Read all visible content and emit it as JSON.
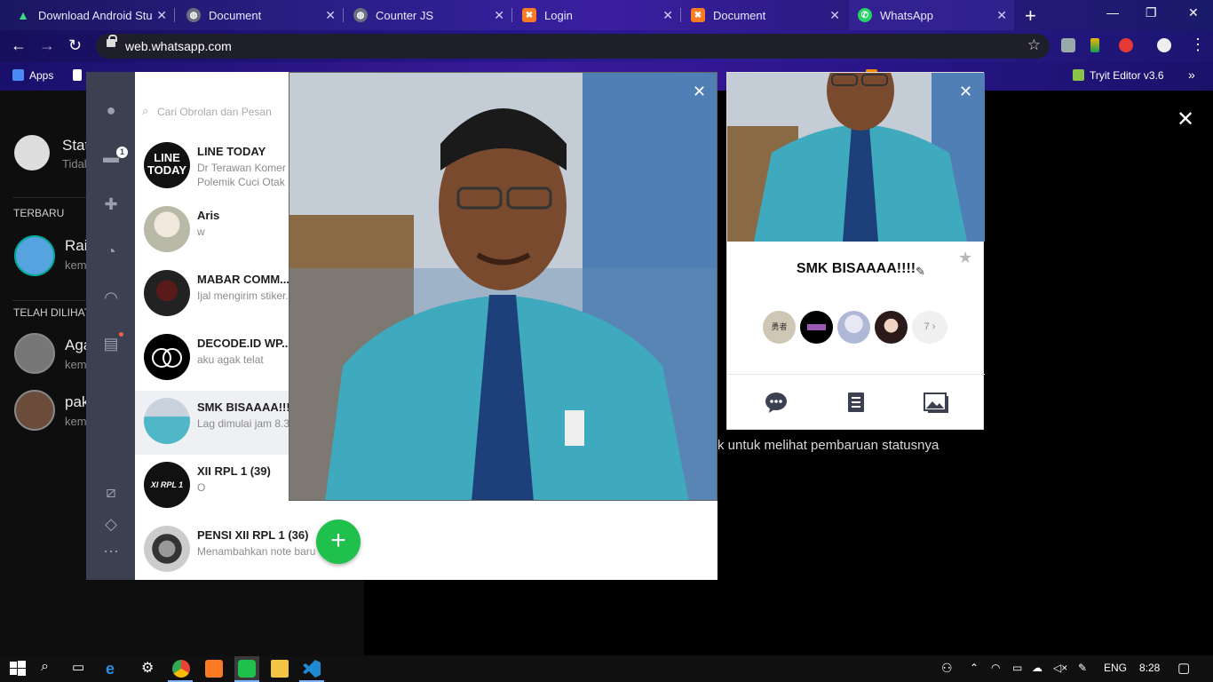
{
  "browser": {
    "tabs": [
      {
        "label": "Download Android Stu",
        "icon": "android-icon",
        "color": "#3ddc84"
      },
      {
        "label": "Document",
        "icon": "globe-icon",
        "color": "#9aa0b0"
      },
      {
        "label": "Counter JS",
        "icon": "globe-icon",
        "color": "#9aa0b0"
      },
      {
        "label": "Login",
        "icon": "xampp-icon",
        "color": "#fb7a24"
      },
      {
        "label": "Document",
        "icon": "xampp-icon",
        "color": "#fb7a24"
      },
      {
        "label": "WhatsApp",
        "icon": "whatsapp-icon",
        "color": "#25d366"
      }
    ],
    "new_tab": "+",
    "url": "web.whatsapp.com",
    "bookmarks": [
      {
        "label": "Apps"
      },
      {
        "label": "Tryit Editor v3.6"
      }
    ],
    "bookmarks_overflow": "»"
  },
  "whatsapp": {
    "my_status": {
      "title": "Stat",
      "sub": "Tidal"
    },
    "recent_header": "TERBARU",
    "recent": [
      {
        "name": "Rai",
        "sub": "kem"
      }
    ],
    "viewed_header": "TELAH DILIHAT",
    "viewed": [
      {
        "name": "Aga",
        "sub": "kem"
      },
      {
        "name": "pak",
        "sub": "kem"
      }
    ],
    "hint": "k untuk melihat pembaruan statusnya",
    "close": "✕"
  },
  "line": {
    "badge": "1",
    "search_placeholder": "Cari Obrolan dan Pesan",
    "chats": [
      {
        "name": "LINE TODAY",
        "preview": "Dr Terawan Komer\nPolemik Cuci Otak",
        "avatar_text": "LINE\nTODAY"
      },
      {
        "name": "Aris",
        "preview": "w"
      },
      {
        "name": "MABAR COMM...",
        "preview": "Ijal mengirim stiker."
      },
      {
        "name": "DECODE.ID WP...",
        "preview": "aku agak telat"
      },
      {
        "name": "SMK BISAAAA!!!",
        "preview": "Lag dimulai jam 8.3"
      },
      {
        "name": "XII RPL 1 (39)",
        "preview": "O",
        "avatar_text": "XI RPL 1"
      },
      {
        "name": "PENSI XII RPL 1 (36)",
        "preview": "Menambahkan note baru"
      }
    ],
    "fab": "+",
    "profile": {
      "name": "SMK BISAAAA!!!!",
      "more_members": "7",
      "member_label": "勇者"
    }
  },
  "taskbar": {
    "lang": "ENG",
    "time": "8:28"
  }
}
